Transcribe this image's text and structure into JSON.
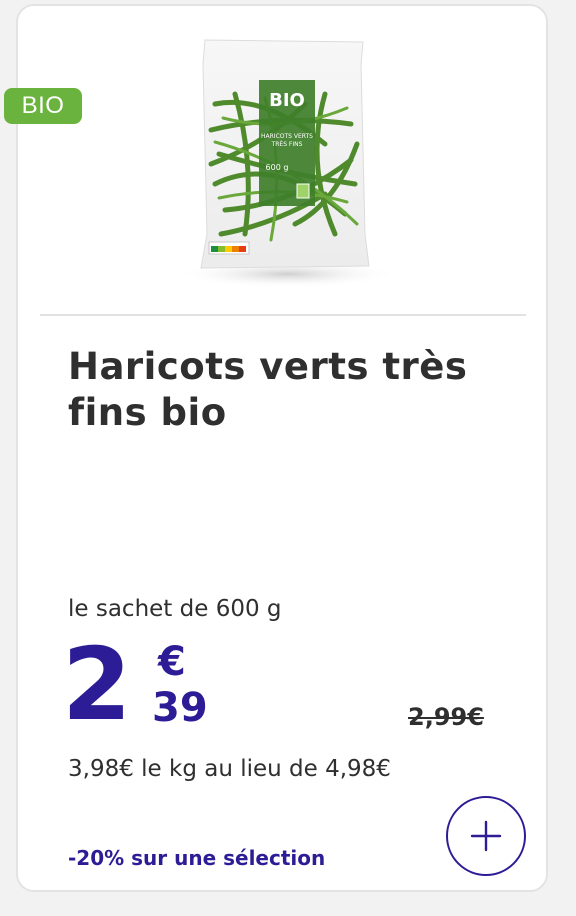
{
  "product": {
    "badge": "BIO",
    "title": "Haricots verts très fins bio",
    "package": {
      "brand_label": "BIO",
      "product_line1": "HARICOTS VERTS",
      "product_line2": "TRÈS FINS",
      "weight": "600 g"
    }
  },
  "pricing": {
    "unit_label": "le sachet de 600 g",
    "price_integer": "2",
    "price_currency": "€",
    "price_cents": "39",
    "old_price": "2,99€",
    "price_per_kg": "3,98€ le kg au lieu de 4,98€",
    "promo_text": "-20% sur une sélection"
  },
  "actions": {
    "add_icon": "plus-icon"
  },
  "colors": {
    "accent": "#2c1d96",
    "bio_green": "#6bb33f",
    "text": "#2f2f2f"
  }
}
